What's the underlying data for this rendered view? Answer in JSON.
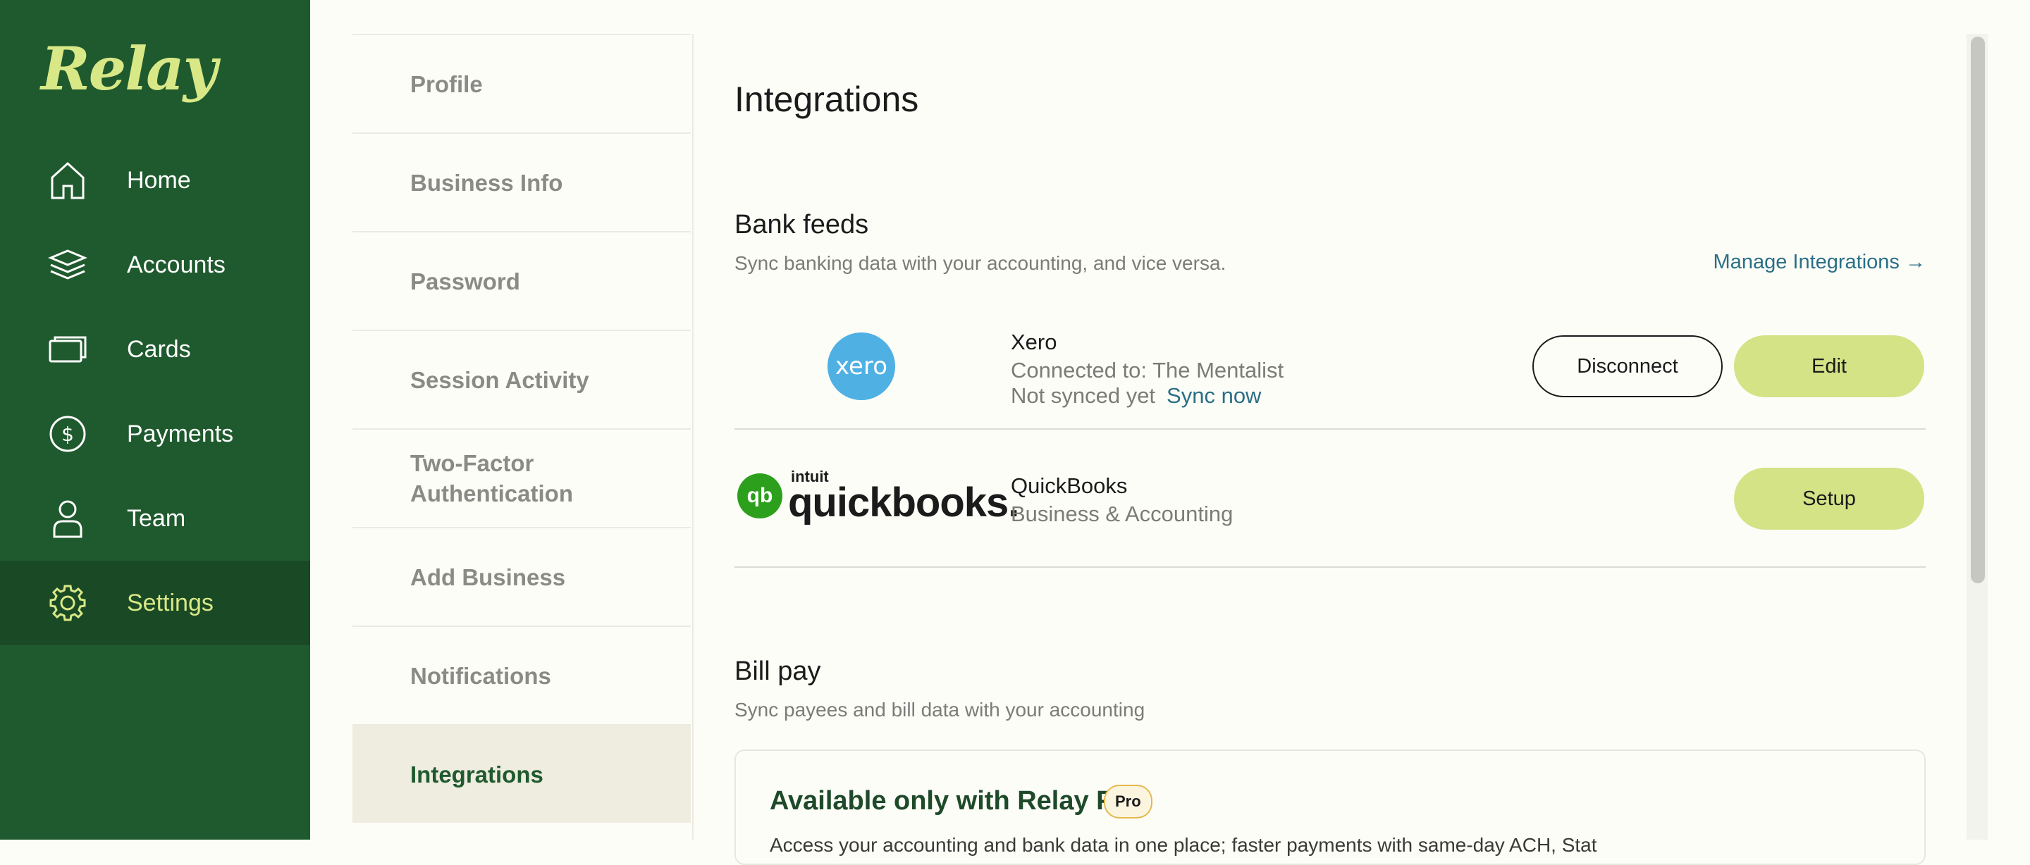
{
  "brand": {
    "logo_text": "Relay"
  },
  "sidebar": {
    "items": [
      {
        "label": "Home",
        "icon": "home-icon"
      },
      {
        "label": "Accounts",
        "icon": "layers-icon"
      },
      {
        "label": "Cards",
        "icon": "card-icon"
      },
      {
        "label": "Payments",
        "icon": "dollar-icon"
      },
      {
        "label": "Team",
        "icon": "user-icon"
      },
      {
        "label": "Settings",
        "icon": "gear-icon",
        "active": true
      }
    ]
  },
  "settings_menu": {
    "items": [
      {
        "label": "Profile"
      },
      {
        "label": "Business Info"
      },
      {
        "label": "Password"
      },
      {
        "label": "Session Activity"
      },
      {
        "label": "Two-Factor Authentication"
      },
      {
        "label": "Add Business"
      },
      {
        "label": "Notifications"
      },
      {
        "label": "Integrations",
        "active": true
      }
    ]
  },
  "main": {
    "title": "Integrations",
    "bank_feeds": {
      "title": "Bank feeds",
      "subtitle": "Sync banking data with your accounting, and vice versa.",
      "manage_link": "Manage Integrations →",
      "integrations": [
        {
          "logo_text": "xero",
          "name": "Xero",
          "detail1": "Connected to: The Mentalist",
          "detail2": "Not synced yet",
          "sync_link": "Sync now",
          "buttons": [
            "Disconnect",
            "Edit"
          ]
        },
        {
          "logo_brand": "intuit",
          "logo_text": "quickbooks.",
          "logo_mark": "qb",
          "name": "QuickBooks",
          "detail1": "Business & Accounting",
          "buttons": [
            "Setup"
          ]
        }
      ]
    },
    "bill_pay": {
      "title": "Bill pay",
      "subtitle": "Sync payees and bill data with your accounting",
      "pro_card": {
        "title": "Available only with Relay Pro",
        "badge": "Pro",
        "desc": "Access your accounting and bank data in one place; faster payments with same-day ACH, Stat"
      }
    }
  },
  "colors": {
    "sidebar_bg": "#1f5a2e",
    "accent_lime": "#d4e386",
    "link": "#2a6f86",
    "xero_blue": "#4fb0e4",
    "quickbooks_green": "#2ca01c"
  }
}
